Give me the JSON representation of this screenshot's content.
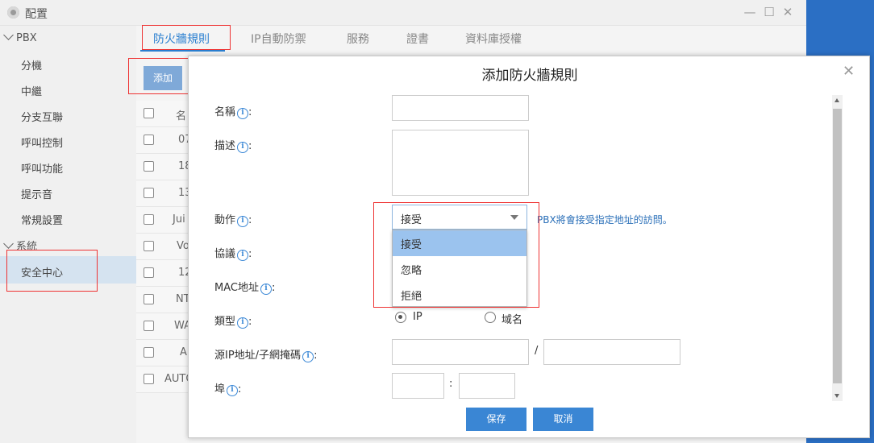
{
  "window": {
    "title": "配置",
    "controls": [
      "minimize-icon",
      "maximize-icon",
      "close-icon"
    ]
  },
  "sidebar": {
    "groups": [
      {
        "label": "PBX",
        "items": [
          "分機",
          "中繼",
          "分支互聯",
          "呼叫控制",
          "呼叫功能",
          "提示音",
          "常規設置"
        ]
      },
      {
        "label": "系統",
        "items": [
          "安全中心"
        ]
      }
    ],
    "active_item": "安全中心"
  },
  "tabs": [
    "防火牆規則",
    "IP自動防禦",
    "服務",
    "證書",
    "資料庫授權"
  ],
  "active_tab": "防火牆規則",
  "toolbar": {
    "add_label": "添加"
  },
  "list": {
    "header_partial": "名",
    "rows_partial": [
      "07",
      "18",
      "13",
      "Jui",
      "Vo",
      "12",
      "NT",
      "WA",
      "A",
      "AUTO"
    ]
  },
  "dialog": {
    "title": "添加防火牆規則",
    "fields": {
      "name_label": "名稱",
      "desc_label": "描述",
      "action_label": "動作",
      "protocol_label": "協議",
      "mac_label": "MAC地址",
      "type_label": "類型",
      "src_label": "源IP地址/子網掩碼",
      "port_label": "埠"
    },
    "colon": ":",
    "action_select": {
      "value": "接受",
      "options": [
        "接受",
        "忽略",
        "拒絕"
      ],
      "highlighted": "接受"
    },
    "action_hint": "PBX將會接受指定地址的訪問。",
    "type_options": [
      {
        "label": "IP",
        "checked": true
      },
      {
        "label": "域名",
        "checked": false
      }
    ],
    "slash": "/",
    "port_sep": ":",
    "buttons": {
      "save": "保存",
      "cancel": "取消"
    }
  },
  "colors": {
    "accent": "#2a7fd0",
    "button_blue": "#3a86d4",
    "selected_option": "#9bc3ee",
    "highlight_box": "#ee3333"
  }
}
